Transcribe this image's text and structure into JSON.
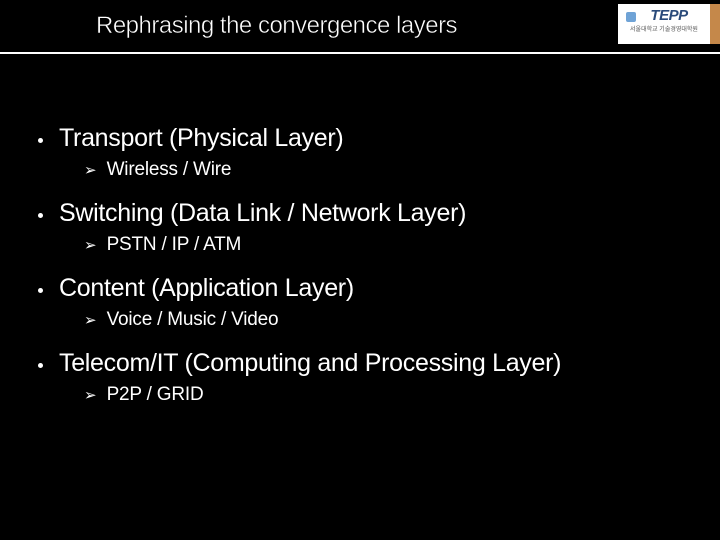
{
  "header": {
    "title": "Rephrasing the convergence layers",
    "logo_text": "TEPP",
    "logo_sub": "서울대학교 기술경영대학원"
  },
  "items": [
    {
      "main": "Transport (Physical Layer)",
      "sub": "Wireless / Wire"
    },
    {
      "main": "Switching (Data Link / Network Layer)",
      "sub": "PSTN / IP / ATM"
    },
    {
      "main": "Content (Application Layer)",
      "sub": "Voice / Music / Video"
    },
    {
      "main": "Telecom/IT (Computing and Processing Layer)",
      "sub": "P2P / GRID"
    }
  ]
}
